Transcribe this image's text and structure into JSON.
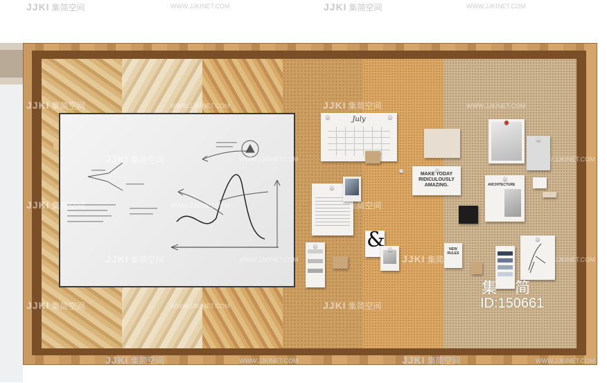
{
  "watermarks": {
    "logo": "JJKI",
    "brand_cn": "集简空间",
    "url": "WWW.JJKINET.COM"
  },
  "calendar": {
    "month": "July"
  },
  "notes": {
    "poster": "MAKE TODAY RIDICULOUSLY AMAZING.",
    "ampersand": "&",
    "architecture_card": "ARCHITECTURE",
    "small_poster": "NEW RULES"
  },
  "id_watermark": {
    "chars": "集 简",
    "code": "ID:150661"
  },
  "colors": {
    "frame_wood": "#c99a62",
    "inner_frame": "#7a4f27",
    "cork": "#dcaa68",
    "whiteboard": "#f4f4f4"
  }
}
